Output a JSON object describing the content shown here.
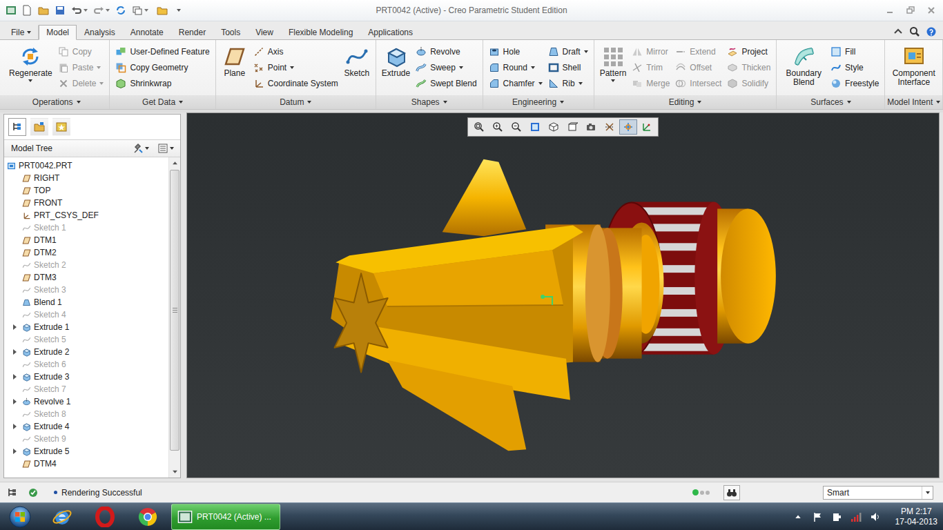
{
  "window": {
    "title": "PRT0042 (Active) - Creo Parametric Student Edition"
  },
  "tabs": [
    {
      "label": "File",
      "kind": "menu",
      "dropdown": true,
      "selected": false
    },
    {
      "label": "Model",
      "kind": "tab",
      "dropdown": false,
      "selected": true
    },
    {
      "label": "Analysis",
      "kind": "tab",
      "dropdown": false,
      "selected": false
    },
    {
      "label": "Annotate",
      "kind": "tab",
      "dropdown": false,
      "selected": false
    },
    {
      "label": "Render",
      "kind": "tab",
      "dropdown": false,
      "selected": false
    },
    {
      "label": "Tools",
      "kind": "tab",
      "dropdown": false,
      "selected": false
    },
    {
      "label": "View",
      "kind": "tab",
      "dropdown": false,
      "selected": false
    },
    {
      "label": "Flexible Modeling",
      "kind": "tab",
      "dropdown": false,
      "selected": false
    },
    {
      "label": "Applications",
      "kind": "tab",
      "dropdown": false,
      "selected": false
    }
  ],
  "ribbon": {
    "groups": [
      {
        "label": "Operations",
        "dropdown": true,
        "items": [
          {
            "kind": "large",
            "entry": {
              "label": "Regenerate",
              "kind": "regenerate",
              "disabled": false,
              "dropdown": true
            }
          },
          {
            "kind": "column",
            "entries": [
              {
                "label": "Copy",
                "kind": "copy",
                "disabled": true,
                "dropdown": false
              },
              {
                "label": "Paste",
                "kind": "paste",
                "disabled": true,
                "dropdown": true
              },
              {
                "label": "Delete",
                "kind": "delete",
                "disabled": true,
                "dropdown": true
              }
            ]
          }
        ]
      },
      {
        "label": "Get Data",
        "dropdown": true,
        "items": [
          {
            "kind": "column",
            "entries": [
              {
                "label": "User-Defined Feature",
                "kind": "udf",
                "disabled": false,
                "dropdown": false
              },
              {
                "label": "Copy Geometry",
                "kind": "copygeom",
                "disabled": false,
                "dropdown": false
              },
              {
                "label": "Shrinkwrap",
                "kind": "shrinkwrap",
                "disabled": false,
                "dropdown": false
              }
            ]
          }
        ]
      },
      {
        "label": "Datum",
        "dropdown": true,
        "items": [
          {
            "kind": "large",
            "entry": {
              "label": "Plane",
              "kind": "plane",
              "disabled": false,
              "dropdown": false
            }
          },
          {
            "kind": "column",
            "entries": [
              {
                "label": "Axis",
                "kind": "axis",
                "disabled": false,
                "dropdown": false
              },
              {
                "label": "Point",
                "kind": "point",
                "disabled": false,
                "dropdown": true
              },
              {
                "label": "Coordinate System",
                "kind": "csys",
                "disabled": false,
                "dropdown": false
              }
            ]
          },
          {
            "kind": "large",
            "entry": {
              "label": "Sketch",
              "kind": "sketch",
              "disabled": false,
              "dropdown": false
            }
          }
        ]
      },
      {
        "label": "Shapes",
        "dropdown": true,
        "items": [
          {
            "kind": "large",
            "entry": {
              "label": "Extrude",
              "kind": "extrude",
              "disabled": false,
              "dropdown": false
            }
          },
          {
            "kind": "column",
            "entries": [
              {
                "label": "Revolve",
                "kind": "revolve",
                "disabled": false,
                "dropdown": false
              },
              {
                "label": "Sweep",
                "kind": "sweep",
                "disabled": false,
                "dropdown": true
              },
              {
                "label": "Swept Blend",
                "kind": "sweptblend",
                "disabled": false,
                "dropdown": false
              }
            ]
          }
        ]
      },
      {
        "label": "Engineering",
        "dropdown": true,
        "items": [
          {
            "kind": "column",
            "entries": [
              {
                "label": "Hole",
                "kind": "hole",
                "disabled": false,
                "dropdown": false
              },
              {
                "label": "Round",
                "kind": "round",
                "disabled": false,
                "dropdown": true
              },
              {
                "label": "Chamfer",
                "kind": "chamfer",
                "disabled": false,
                "dropdown": true
              }
            ]
          },
          {
            "kind": "column",
            "entries": [
              {
                "label": "Draft",
                "kind": "draft",
                "disabled": false,
                "dropdown": true
              },
              {
                "label": "Shell",
                "kind": "shell",
                "disabled": false,
                "dropdown": false
              },
              {
                "label": "Rib",
                "kind": "rib",
                "disabled": false,
                "dropdown": true
              }
            ]
          }
        ]
      },
      {
        "label": "Editing",
        "dropdown": true,
        "items": [
          {
            "kind": "large",
            "entry": {
              "label": "Pattern",
              "kind": "pattern",
              "disabled": false,
              "dropdown": true
            }
          },
          {
            "kind": "column",
            "entries": [
              {
                "label": "Mirror",
                "kind": "mirror",
                "disabled": true,
                "dropdown": false
              },
              {
                "label": "Trim",
                "kind": "trim",
                "disabled": true,
                "dropdown": false
              },
              {
                "label": "Merge",
                "kind": "merge",
                "disabled": true,
                "dropdown": false
              }
            ]
          },
          {
            "kind": "column",
            "entries": [
              {
                "label": "Extend",
                "kind": "extend",
                "disabled": true,
                "dropdown": false
              },
              {
                "label": "Offset",
                "kind": "offset",
                "disabled": true,
                "dropdown": false
              },
              {
                "label": "Intersect",
                "kind": "intersect",
                "disabled": true,
                "dropdown": false
              }
            ]
          },
          {
            "kind": "column",
            "entries": [
              {
                "label": "Project",
                "kind": "project",
                "disabled": false,
                "dropdown": false
              },
              {
                "label": "Thicken",
                "kind": "thicken",
                "disabled": true,
                "dropdown": false
              },
              {
                "label": "Solidify",
                "kind": "solidify",
                "disabled": true,
                "dropdown": false
              }
            ]
          }
        ]
      },
      {
        "label": "Surfaces",
        "dropdown": true,
        "items": [
          {
            "kind": "large",
            "entry": {
              "label": "Boundary Blend",
              "kind": "boundaryblend",
              "disabled": false,
              "dropdown": false
            }
          },
          {
            "kind": "column",
            "entries": [
              {
                "label": "Fill",
                "kind": "fill",
                "disabled": false,
                "dropdown": false
              },
              {
                "label": "Style",
                "kind": "style",
                "disabled": false,
                "dropdown": false
              },
              {
                "label": "Freestyle",
                "kind": "freestyle",
                "disabled": false,
                "dropdown": false
              }
            ]
          }
        ]
      },
      {
        "label": "Model Intent",
        "dropdown": true,
        "items": [
          {
            "kind": "large",
            "entry": {
              "label": "Component Interface",
              "kind": "component",
              "disabled": false,
              "dropdown": false
            }
          }
        ]
      }
    ]
  },
  "panel_tabs": [
    {
      "kind": "tree",
      "selected": true
    },
    {
      "kind": "folder",
      "selected": false
    },
    {
      "kind": "favorites",
      "selected": false
    }
  ],
  "model_tree": {
    "title": "Model Tree",
    "scrollbar_level": 0.95,
    "root": {
      "label": "PRT0042.PRT",
      "kind": "root"
    },
    "items": [
      {
        "label": "RIGHT",
        "kind": "plane",
        "expandable": false,
        "expanded": false,
        "dimmed": false
      },
      {
        "label": "TOP",
        "kind": "plane",
        "expandable": false,
        "expanded": false,
        "dimmed": false
      },
      {
        "label": "FRONT",
        "kind": "plane",
        "expandable": false,
        "expanded": false,
        "dimmed": false
      },
      {
        "label": "PRT_CSYS_DEF",
        "kind": "csys",
        "expandable": false,
        "expanded": false,
        "dimmed": false
      },
      {
        "label": "Sketch 1",
        "kind": "sketch",
        "expandable": false,
        "expanded": false,
        "dimmed": true
      },
      {
        "label": "DTM1",
        "kind": "plane",
        "expandable": false,
        "expanded": false,
        "dimmed": false
      },
      {
        "label": "DTM2",
        "kind": "plane",
        "expandable": false,
        "expanded": false,
        "dimmed": false
      },
      {
        "label": "Sketch 2",
        "kind": "sketch",
        "expandable": false,
        "expanded": false,
        "dimmed": true
      },
      {
        "label": "DTM3",
        "kind": "plane",
        "expandable": false,
        "expanded": false,
        "dimmed": false
      },
      {
        "label": "Sketch 3",
        "kind": "sketch",
        "expandable": false,
        "expanded": false,
        "dimmed": true
      },
      {
        "label": "Blend 1",
        "kind": "blend",
        "expandable": false,
        "expanded": false,
        "dimmed": false
      },
      {
        "label": "Sketch 4",
        "kind": "sketch",
        "expandable": false,
        "expanded": false,
        "dimmed": true
      },
      {
        "label": "Extrude 1",
        "kind": "extrude",
        "expandable": true,
        "expanded": false,
        "dimmed": false
      },
      {
        "label": "Sketch 5",
        "kind": "sketch",
        "expandable": false,
        "expanded": false,
        "dimmed": true
      },
      {
        "label": "Extrude 2",
        "kind": "extrude",
        "expandable": true,
        "expanded": false,
        "dimmed": false
      },
      {
        "label": "Sketch 6",
        "kind": "sketch",
        "expandable": false,
        "expanded": false,
        "dimmed": true
      },
      {
        "label": "Extrude 3",
        "kind": "extrude",
        "expandable": true,
        "expanded": false,
        "dimmed": false
      },
      {
        "label": "Sketch 7",
        "kind": "sketch",
        "expandable": false,
        "expanded": false,
        "dimmed": true
      },
      {
        "label": "Revolve 1",
        "kind": "revolve",
        "expandable": true,
        "expanded": false,
        "dimmed": false
      },
      {
        "label": "Sketch 8",
        "kind": "sketch",
        "expandable": false,
        "expanded": false,
        "dimmed": true
      },
      {
        "label": "Extrude 4",
        "kind": "extrude",
        "expandable": true,
        "expanded": false,
        "dimmed": false
      },
      {
        "label": "Sketch 9",
        "kind": "sketch",
        "expandable": false,
        "expanded": false,
        "dimmed": true
      },
      {
        "label": "Extrude 5",
        "kind": "extrude",
        "expandable": true,
        "expanded": false,
        "dimmed": false
      },
      {
        "label": "DTM4",
        "kind": "plane",
        "expandable": false,
        "expanded": false,
        "dimmed": false
      }
    ]
  },
  "graphics_toolbar": [
    {
      "kind": "refit",
      "pressed": false
    },
    {
      "kind": "zoomin",
      "pressed": false
    },
    {
      "kind": "zoomout",
      "pressed": false
    },
    {
      "kind": "repaint",
      "pressed": false
    },
    {
      "kind": "display",
      "pressed": false
    },
    {
      "kind": "orient",
      "pressed": false
    },
    {
      "kind": "views",
      "pressed": false
    },
    {
      "kind": "datum",
      "pressed": false
    },
    {
      "kind": "spin",
      "pressed": true
    },
    {
      "kind": "annotation",
      "pressed": false
    }
  ],
  "status_bar": {
    "message": "Rendering Successful",
    "selection_filter": "Smart"
  },
  "taskbar": {
    "apps": [
      {
        "label": "PRT0042 (Active) ...",
        "active": true
      }
    ],
    "clock": {
      "time": "PM 2:17",
      "date": "17-04-2013"
    }
  }
}
